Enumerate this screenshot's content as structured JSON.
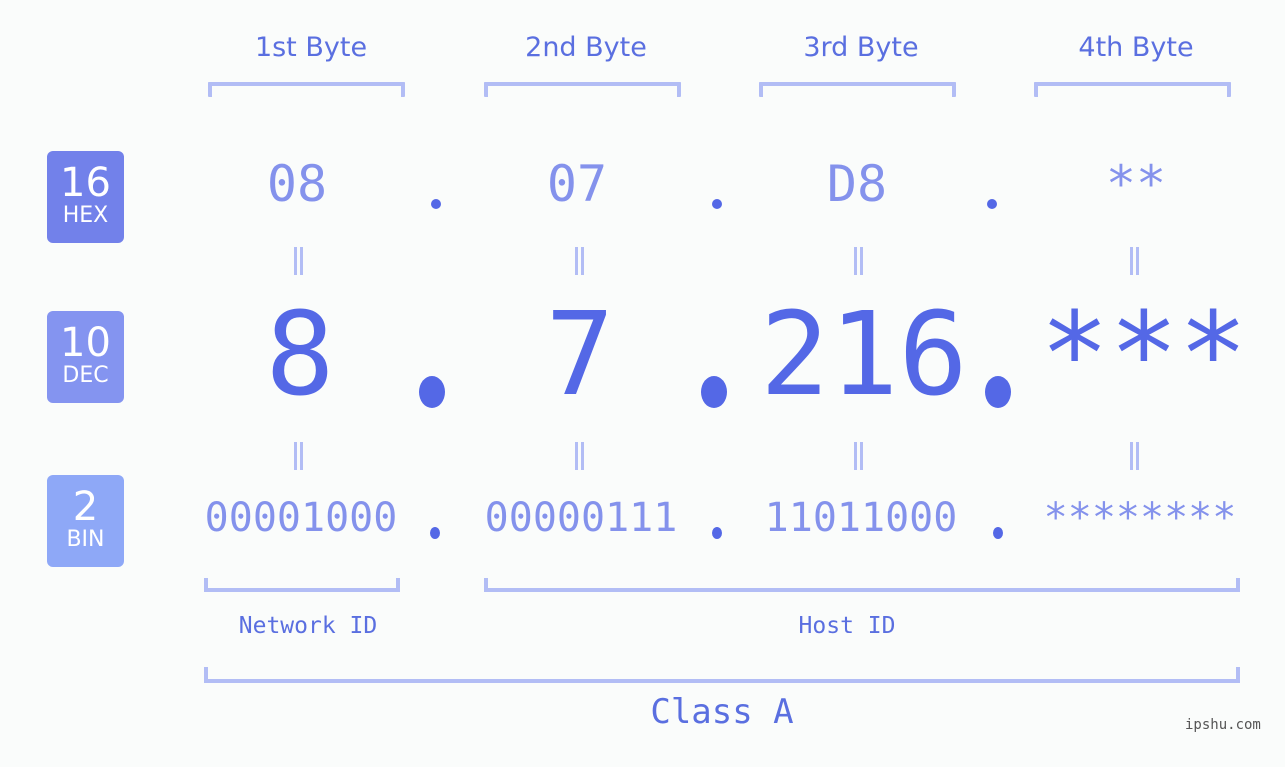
{
  "byte_headers": [
    "1st Byte",
    "2nd Byte",
    "3rd Byte",
    "4th Byte"
  ],
  "badges": [
    {
      "num": "16",
      "unit": "HEX",
      "color": "#7281ea"
    },
    {
      "num": "10",
      "unit": "DEC",
      "color": "#8494f0"
    },
    {
      "num": "2",
      "unit": "BIN",
      "color": "#8ea8f7"
    }
  ],
  "hex_values": [
    "08",
    "07",
    "D8",
    "**"
  ],
  "dec_values": [
    "8",
    "7",
    "216",
    "***"
  ],
  "bin_values": [
    "00001000",
    "00000111",
    "11011000",
    "********"
  ],
  "segments": {
    "network_label": "Network ID",
    "host_label": "Host ID",
    "class_label": "Class A"
  },
  "watermark": "ipshu.com",
  "colors": {
    "accent": "#5468e6",
    "light_accent": "#8492ec",
    "bracket": "#b2bdf5",
    "background": "#fafcfb"
  }
}
